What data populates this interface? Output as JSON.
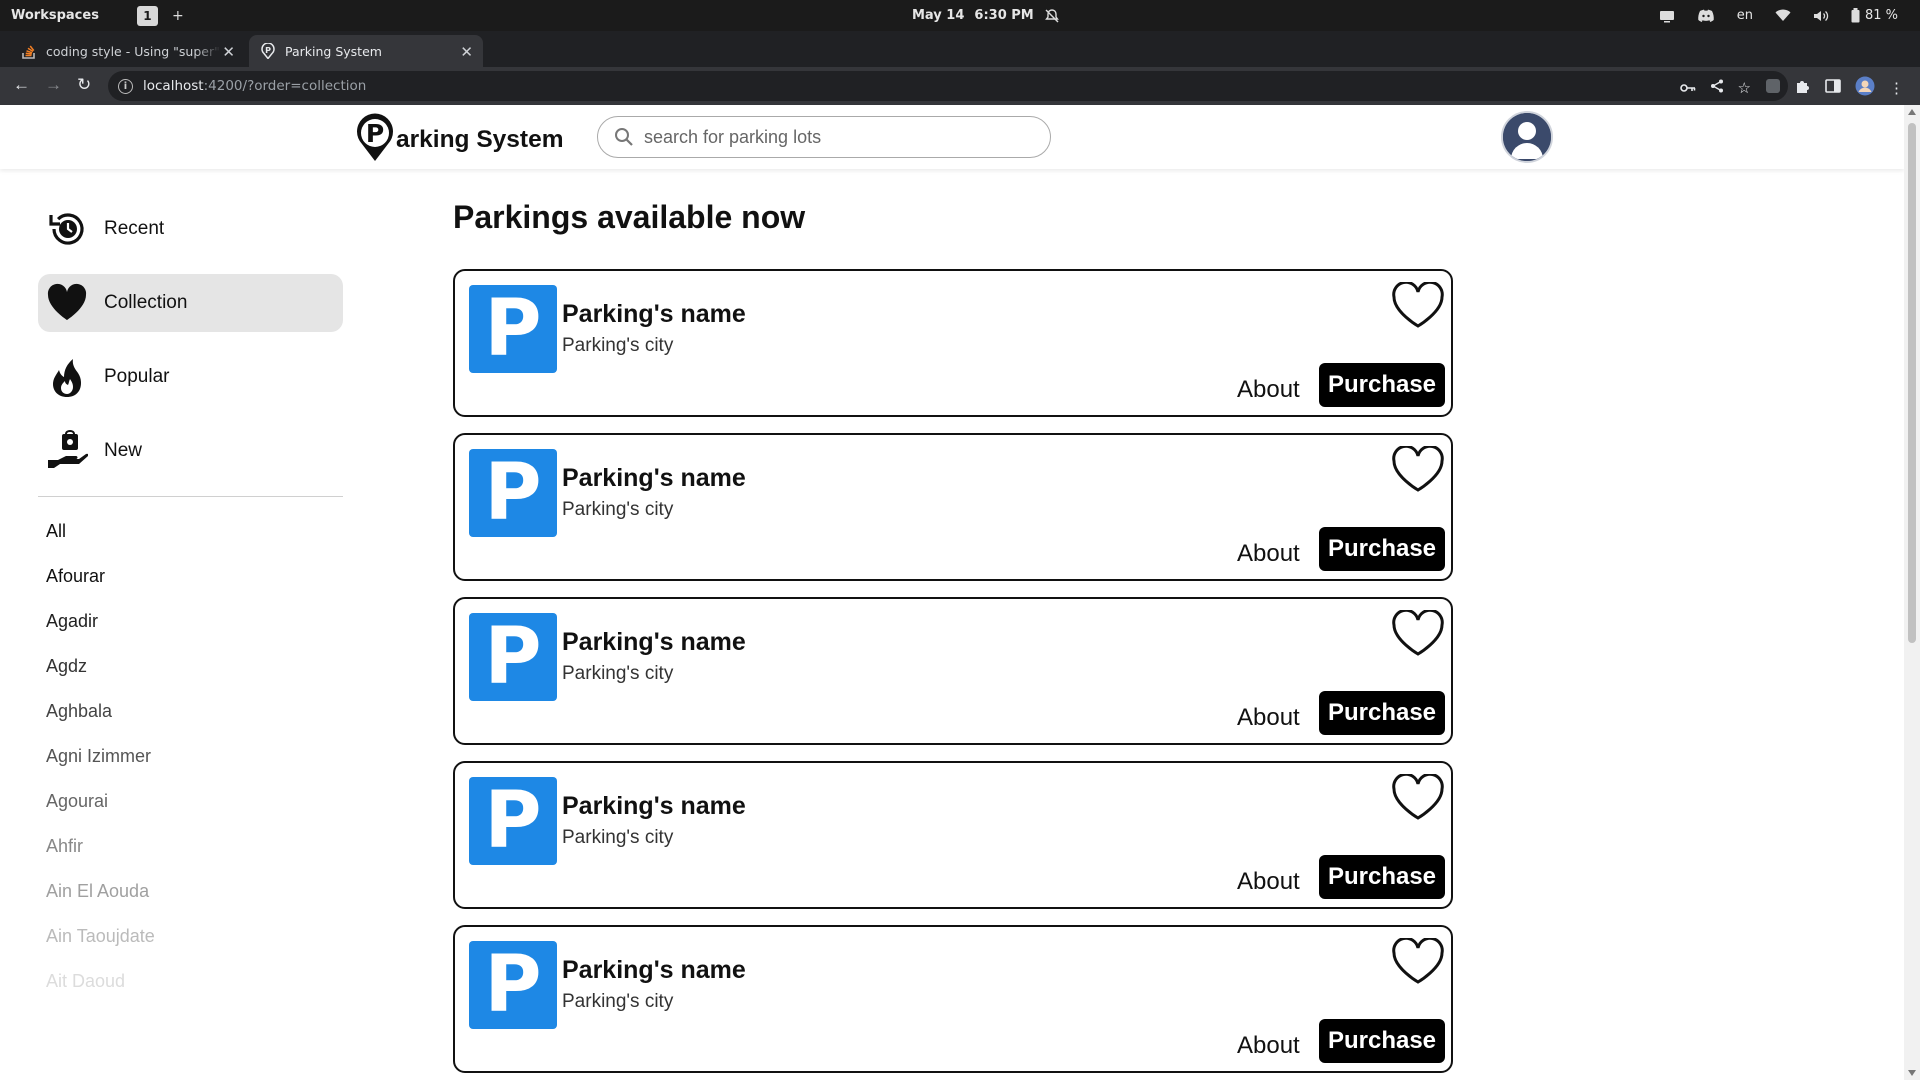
{
  "system_bar": {
    "workspaces_label": "Workspaces",
    "workspace_number": "1",
    "add_symbol": "+",
    "date": "May 14",
    "time": "6:30 PM",
    "language": "en",
    "battery": "81 %"
  },
  "browser": {
    "tabs": [
      {
        "title": "coding style - Using \"super\" in"
      },
      {
        "title": "Parking System"
      }
    ],
    "url_host": "localhost",
    "url_rest": ":4200/?order=collection"
  },
  "app": {
    "logo_text": "arking System",
    "search_placeholder": "search for parking lots"
  },
  "sidebar": {
    "items": [
      {
        "label": "Recent",
        "icon": "history-icon"
      },
      {
        "label": "Collection",
        "icon": "heart-icon",
        "active": true
      },
      {
        "label": "Popular",
        "icon": "fire-icon"
      },
      {
        "label": "New",
        "icon": "gift-hand-icon"
      }
    ],
    "cities": [
      "All",
      "Afourar",
      "Agadir",
      "Agdz",
      "Aghbala",
      "Agni Izimmer",
      "Agourai",
      "Ahfir",
      "Ain El Aouda",
      "Ain Taoujdate",
      "Ait Daoud"
    ]
  },
  "main": {
    "title": "Parkings available now",
    "cards": [
      {
        "name": "Parking's name",
        "city": "Parking's city",
        "about": "About",
        "purchase": "Purchase",
        "thumb_letter": "P"
      },
      {
        "name": "Parking's name",
        "city": "Parking's city",
        "about": "About",
        "purchase": "Purchase",
        "thumb_letter": "P"
      },
      {
        "name": "Parking's name",
        "city": "Parking's city",
        "about": "About",
        "purchase": "Purchase",
        "thumb_letter": "P"
      },
      {
        "name": "Parking's name",
        "city": "Parking's city",
        "about": "About",
        "purchase": "Purchase",
        "thumb_letter": "P"
      },
      {
        "name": "Parking's name",
        "city": "Parking's city",
        "about": "About",
        "purchase": "Purchase",
        "thumb_letter": "P"
      }
    ]
  },
  "colors": {
    "accent_blue": "#1e88e5",
    "purchase_bg": "#000000",
    "active_item_bg": "#e5e5e5"
  }
}
